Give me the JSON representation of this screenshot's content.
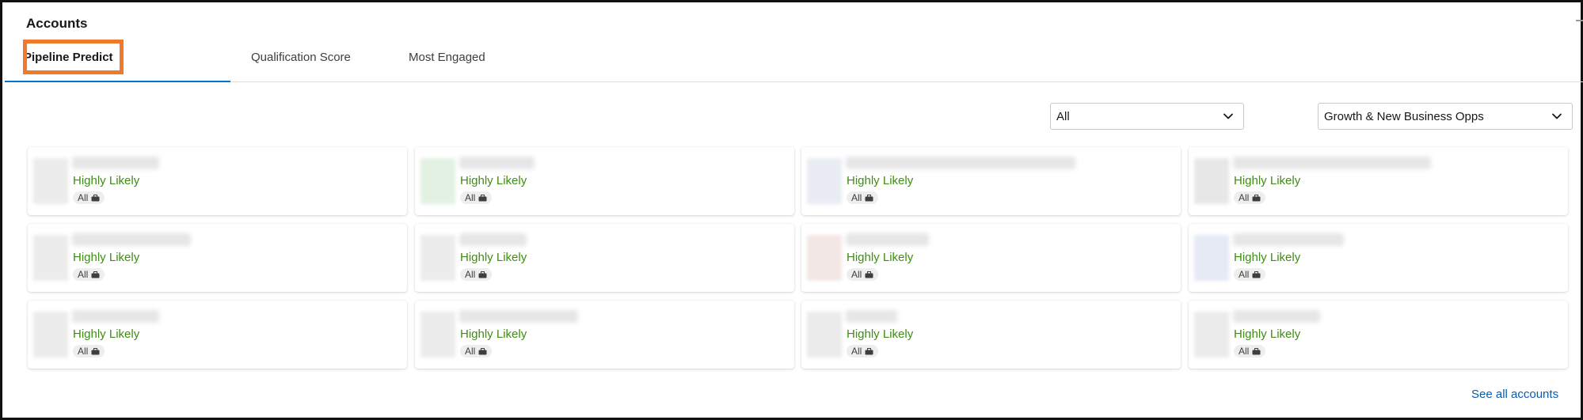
{
  "header": {
    "title": "Accounts"
  },
  "tabs": [
    {
      "label": "Pipeline Predict",
      "active": true
    },
    {
      "label": "Qualification Score",
      "active": false
    },
    {
      "label": "Most Engaged",
      "active": false
    }
  ],
  "filters": {
    "segment": {
      "value": "All"
    },
    "opportunity_type": {
      "value": "Growth & New Business Opps"
    }
  },
  "cards": [
    {
      "rating": "Highly Likely",
      "tag": "All"
    },
    {
      "rating": "Highly Likely",
      "tag": "All"
    },
    {
      "rating": "Highly Likely",
      "tag": "All"
    },
    {
      "rating": "Highly Likely",
      "tag": "All"
    },
    {
      "rating": "Highly Likely",
      "tag": "All"
    },
    {
      "rating": "Highly Likely",
      "tag": "All"
    },
    {
      "rating": "Highly Likely",
      "tag": "All"
    },
    {
      "rating": "Highly Likely",
      "tag": "All"
    },
    {
      "rating": "Highly Likely",
      "tag": "All"
    },
    {
      "rating": "Highly Likely",
      "tag": "All"
    },
    {
      "rating": "Highly Likely",
      "tag": "All"
    },
    {
      "rating": "Highly Likely",
      "tag": "All"
    }
  ],
  "footer": {
    "see_all_label": "See all accounts"
  },
  "colors": {
    "rating": "#3e8d12",
    "link": "#0b5cab",
    "active_tab_underline": "#0176d3",
    "annotation_highlight": "#f07a2a"
  },
  "icons": {
    "dropdown": "chevron-down-icon",
    "tag": "briefcase-icon"
  }
}
